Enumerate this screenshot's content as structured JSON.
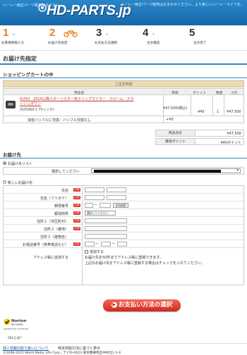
{
  "header": {
    "tagline": "ハーレー純正パーツ販売＆カスタム",
    "logo": "HD-PARTS.jp",
    "desc": "ハーレー純正パーツ販売はおまかせください。より楽しいハーレーライフを。"
  },
  "steps": [
    {
      "num": "1",
      "label": "お客様情報入力"
    },
    {
      "num": "2",
      "label": "お届け先指定"
    },
    {
      "num": "3",
      "label": "お支払方法選択"
    },
    {
      "num": "4",
      "label": "注文確認"
    },
    {
      "num": "5",
      "label": "注文完了"
    }
  ],
  "page_title": "お届け先指定",
  "cart": {
    "section_title": "ショッピングカートの中",
    "caption": "ご注文内容",
    "headers": {
      "name": "商品名",
      "price": "単価",
      "point": "ポイント",
      "qty": "数量",
      "subtotal": "小計"
    },
    "item": {
      "name": "RUSH　2014以降スポーツスター用スリップマフラー　クローム　スラッシュダウン",
      "code": "(625064:1.75インチ)",
      "price": "¥47,500(税込)",
      "point": "440",
      "qty": "1",
      "subtotal": "¥47,500"
    },
    "option": {
      "text": "消音バッフルに交換：バッフル交換なし",
      "price": "+¥0"
    },
    "total_label": "商品合計",
    "total_value": "¥47,500",
    "points_label": "獲得ポイント",
    "points_value": "440ポイント"
  },
  "delivery": {
    "section_title": "お届け先",
    "list_option": "お届け先リスト",
    "select_label": "選択してください",
    "new_option": "新しいお届け先",
    "fields": {
      "name": "氏名",
      "kana": "氏名（フリガナ）",
      "zip": "郵便番号",
      "pref": "都道府県",
      "addr1": "住所１（市区町村）",
      "addr2": "住所２（番地）",
      "addr3": "住所３（建物名）",
      "tel": "お電話番号（携帯電話など）",
      "addbook": "アドレス帳に追加する"
    },
    "required": "必須",
    "zip_separator": "ー",
    "zip_button": "住所検索",
    "pref_placeholder": "選択してください",
    "tel_separator": "ー",
    "addbook_check": "追加する",
    "addbook_note1": "お届け先を50件までアドレス帳に登録できます。",
    "addbook_note2": "上記のお届け先をアドレス帳に登録する場合はチェックを入れてください。"
  },
  "pay_button": "お支払い方法の選択",
  "norton": {
    "brand": "Norton",
    "sub": "SECURED",
    "powered": "powered by Symantec",
    "ssl": "SSLとは？"
  },
  "footer": {
    "privacy": "個人情報の取り扱いについて",
    "law": "特定商取引法に基づく表示",
    "copyright": "©2008-2015 World Motor Life Corp., 〒176-0023 東京都練馬区中村北1-1-4"
  },
  "colors": {
    "brand": "#1667a8",
    "accent": "#e8801a",
    "button": "#d0271a"
  }
}
